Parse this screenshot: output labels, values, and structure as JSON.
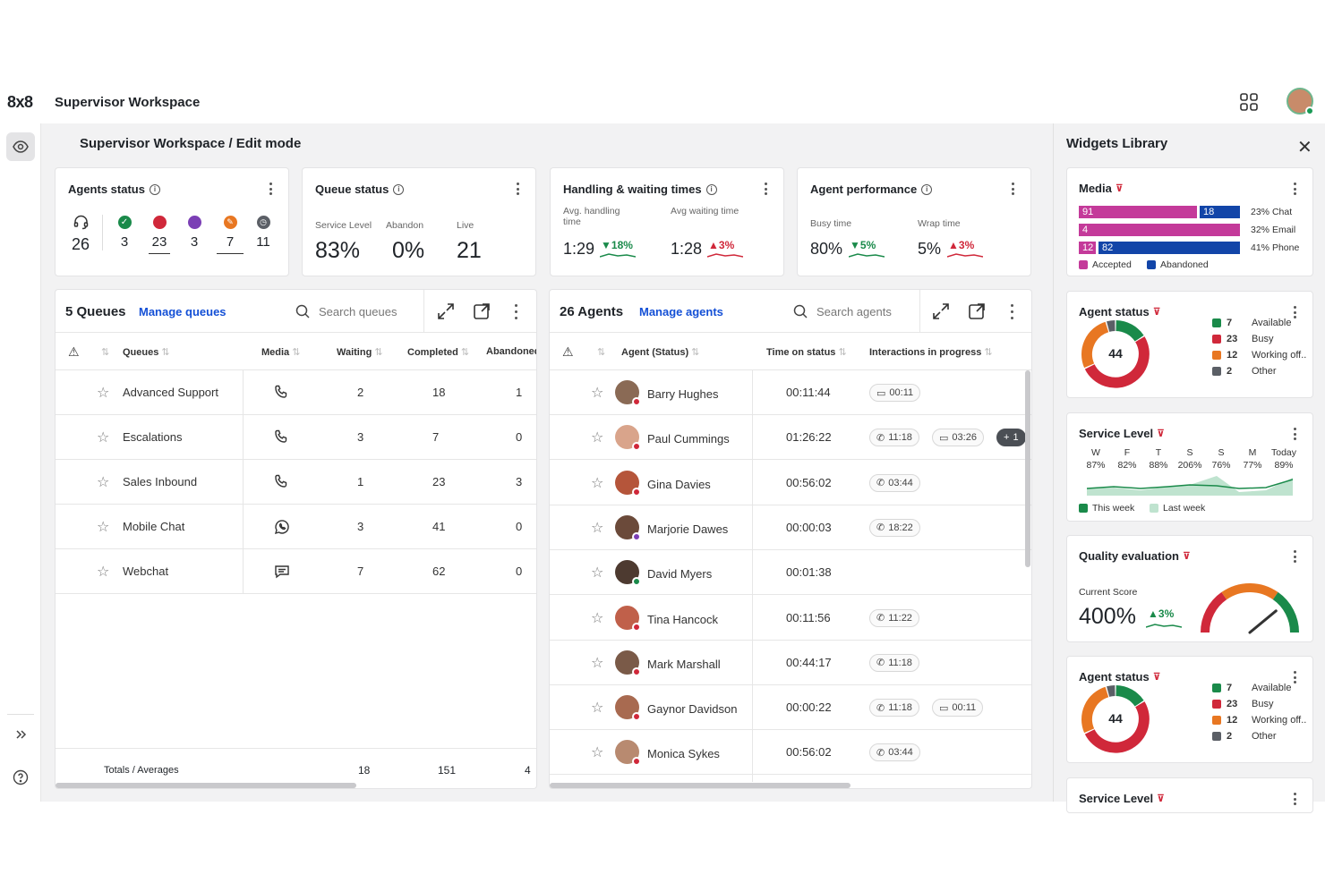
{
  "app": {
    "logo": "8x8",
    "title": "Supervisor Workspace",
    "page_title": "Supervisor Workspace / Edit mode"
  },
  "colors": {
    "green": "#1a8a4a",
    "red": "#d0283a",
    "purple": "#7b3fb5",
    "orange": "#e87722",
    "gray": "#5b5f66",
    "magenta": "#c43a9a",
    "blue": "#1245a8",
    "link": "#1450d6"
  },
  "agents_status": {
    "title": "Agents status",
    "total": "26",
    "items": [
      {
        "icon": "check-circle-icon",
        "value": "3"
      },
      {
        "icon": "busy-dot-icon",
        "value": "23"
      },
      {
        "icon": "purple-dot-icon",
        "value": "3"
      },
      {
        "icon": "pencil-circle-icon",
        "value": "7"
      },
      {
        "icon": "clock-icon",
        "value": "11"
      }
    ]
  },
  "queue_status": {
    "title": "Queue status",
    "service_level_label": "Service Level",
    "abandon_label": "Abandon",
    "live_label": "Live",
    "service_level": "83%",
    "abandon": "0%",
    "live": "21"
  },
  "handling": {
    "title": "Handling & waiting times",
    "avg_handling_label": "Avg. handling time",
    "avg_waiting_label": "Avg waiting time",
    "avg_handling": "1:29",
    "avg_handling_trend": "18%",
    "avg_waiting": "1:28",
    "avg_waiting_trend": "3%"
  },
  "performance": {
    "title": "Agent performance",
    "busy_label": "Busy time",
    "wrap_label": "Wrap time",
    "busy": "80%",
    "busy_trend": "5%",
    "wrap": "5%",
    "wrap_trend": "3%"
  },
  "queues": {
    "title": "5 Queues",
    "manage": "Manage queues",
    "search_placeholder": "Search queues",
    "cols": [
      "Queues",
      "Media",
      "Waiting",
      "Completed",
      "Abandoned"
    ],
    "rows": [
      {
        "name": "Advanced Support",
        "media": "phone-icon",
        "waiting": "2",
        "completed": "18",
        "abandoned": "1"
      },
      {
        "name": "Escalations",
        "media": "phone-icon",
        "waiting": "3",
        "completed": "7",
        "abandoned": "0"
      },
      {
        "name": "Sales Inbound",
        "media": "phone-icon",
        "waiting": "1",
        "completed": "23",
        "abandoned": "3"
      },
      {
        "name": "Mobile Chat",
        "media": "whatsapp-icon",
        "waiting": "3",
        "completed": "41",
        "abandoned": "0"
      },
      {
        "name": "Webchat",
        "media": "chat-icon",
        "waiting": "7",
        "completed": "62",
        "abandoned": "0"
      }
    ],
    "totals_label": "Totals / Averages",
    "totals": {
      "waiting": "18",
      "completed": "151",
      "abandoned": "4"
    }
  },
  "agents": {
    "title": "26 Agents",
    "manage": "Manage agents",
    "search_placeholder": "Search agents",
    "cols": [
      "Agent (Status)",
      "Time on status",
      "Interactions in progress"
    ],
    "rows": [
      {
        "name": "Barry Hughes",
        "time": "00:11:44",
        "status": "red",
        "pills": [
          {
            "icon": "chat-icon",
            "text": "00:11"
          }
        ]
      },
      {
        "name": "Paul Cummings",
        "time": "01:26:22",
        "status": "red",
        "pills": [
          {
            "icon": "phone-icon",
            "text": "11:18"
          },
          {
            "icon": "chat-icon",
            "text": "03:26"
          },
          {
            "icon": "plus-icon",
            "text": "1",
            "dark": true
          }
        ]
      },
      {
        "name": "Gina Davies",
        "time": "00:56:02",
        "status": "red",
        "pills": [
          {
            "icon": "phone-icon",
            "text": "03:44"
          }
        ]
      },
      {
        "name": "Marjorie Dawes",
        "time": "00:00:03",
        "status": "purple",
        "pills": [
          {
            "icon": "phone-icon",
            "text": "18:22"
          }
        ]
      },
      {
        "name": "David Myers",
        "time": "00:01:38",
        "status": "green",
        "pills": []
      },
      {
        "name": "Tina Hancock",
        "time": "00:11:56",
        "status": "red",
        "pills": [
          {
            "icon": "phone-icon",
            "text": "11:22"
          }
        ]
      },
      {
        "name": "Mark Marshall",
        "time": "00:44:17",
        "status": "red",
        "pills": [
          {
            "icon": "phone-icon",
            "text": "11:18"
          }
        ]
      },
      {
        "name": "Gaynor Davidson",
        "time": "00:00:22",
        "status": "red",
        "pills": [
          {
            "icon": "phone-icon",
            "text": "11:18"
          },
          {
            "icon": "chat-icon",
            "text": "00:11"
          }
        ]
      },
      {
        "name": "Monica Sykes",
        "time": "00:56:02",
        "status": "red",
        "pills": [
          {
            "icon": "phone-icon",
            "text": "03:44"
          }
        ]
      }
    ]
  },
  "library": {
    "title": "Widgets Library",
    "media": {
      "title": "Media",
      "rows": [
        {
          "accepted": "91",
          "abandoned": "18",
          "accepted_frac": 0.75,
          "pct": "23%",
          "label": "Chat"
        },
        {
          "accepted": "4",
          "abandoned": "",
          "accepted_frac": 1.0,
          "pct": "32%",
          "label": "Email"
        },
        {
          "accepted": "12",
          "abandoned": "82",
          "accepted_frac": 0.12,
          "pct": "41%",
          "label": "Phone"
        }
      ],
      "legend_accepted": "Accepted",
      "legend_abandoned": "Abandoned"
    },
    "agent_status": {
      "title": "Agent status",
      "total": "44",
      "items": [
        {
          "value": "7",
          "label": "Available",
          "color": "#1a8a4a"
        },
        {
          "value": "23",
          "label": "Busy",
          "color": "#d0283a"
        },
        {
          "value": "12",
          "label": "Working off..",
          "color": "#e87722"
        },
        {
          "value": "2",
          "label": "Other",
          "color": "#5b5f66"
        }
      ]
    },
    "service_level": {
      "title": "Service Level",
      "days": [
        {
          "d": "W",
          "v": "87%"
        },
        {
          "d": "F",
          "v": "82%"
        },
        {
          "d": "T",
          "v": "88%"
        },
        {
          "d": "S",
          "v": "206%"
        },
        {
          "d": "S",
          "v": "76%"
        },
        {
          "d": "M",
          "v": "77%"
        },
        {
          "d": "Today",
          "v": "89%"
        }
      ],
      "this_week": "This week",
      "last_week": "Last week"
    },
    "quality": {
      "title": "Quality evaluation",
      "label": "Current Score",
      "score": "400%",
      "trend": "3%",
      "gauge_frac": 0.78
    },
    "service_level_2": {
      "title": "Service Level"
    }
  }
}
